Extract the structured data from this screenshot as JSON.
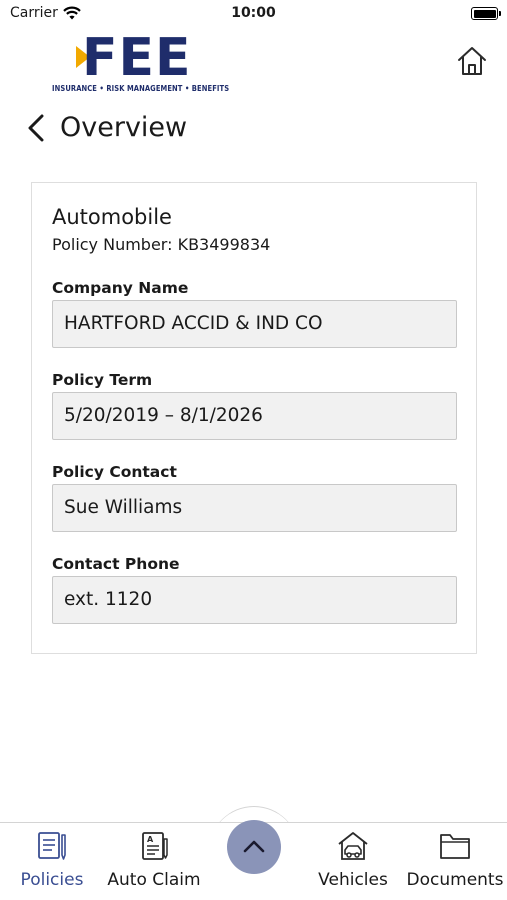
{
  "status_bar": {
    "carrier": "Carrier",
    "time": "10:00"
  },
  "brand": {
    "logo_text": "FEE",
    "tagline": "INSURANCE • RISK MANAGEMENT • BENEFITS",
    "primary_color": "#1f2d6b",
    "accent_color": "#f2a900"
  },
  "header": {
    "home_icon": "home-icon",
    "back_icon": "chevron-left-icon",
    "title": "Overview"
  },
  "policy": {
    "type": "Automobile",
    "number_line": "Policy Number: KB3499834",
    "fields": [
      {
        "label": "Company Name",
        "value": "HARTFORD ACCID & IND CO"
      },
      {
        "label": "Policy Term",
        "value": "5/20/2019 – 8/1/2026"
      },
      {
        "label": "Policy Contact",
        "value": "Sue Williams"
      },
      {
        "label": "Contact Phone",
        "value": "ext. 1120"
      }
    ]
  },
  "tabbar": {
    "tabs": [
      {
        "label": "Policies",
        "icon": "policies-icon",
        "active": true
      },
      {
        "label": "Auto Claim",
        "icon": "auto-claim-icon",
        "active": false
      },
      {
        "label": "Vehicles",
        "icon": "vehicles-icon",
        "active": false
      },
      {
        "label": "Documents",
        "icon": "documents-icon",
        "active": false
      }
    ],
    "center_button_icon": "chevron-up-icon",
    "active_color": "#3a4e92"
  }
}
